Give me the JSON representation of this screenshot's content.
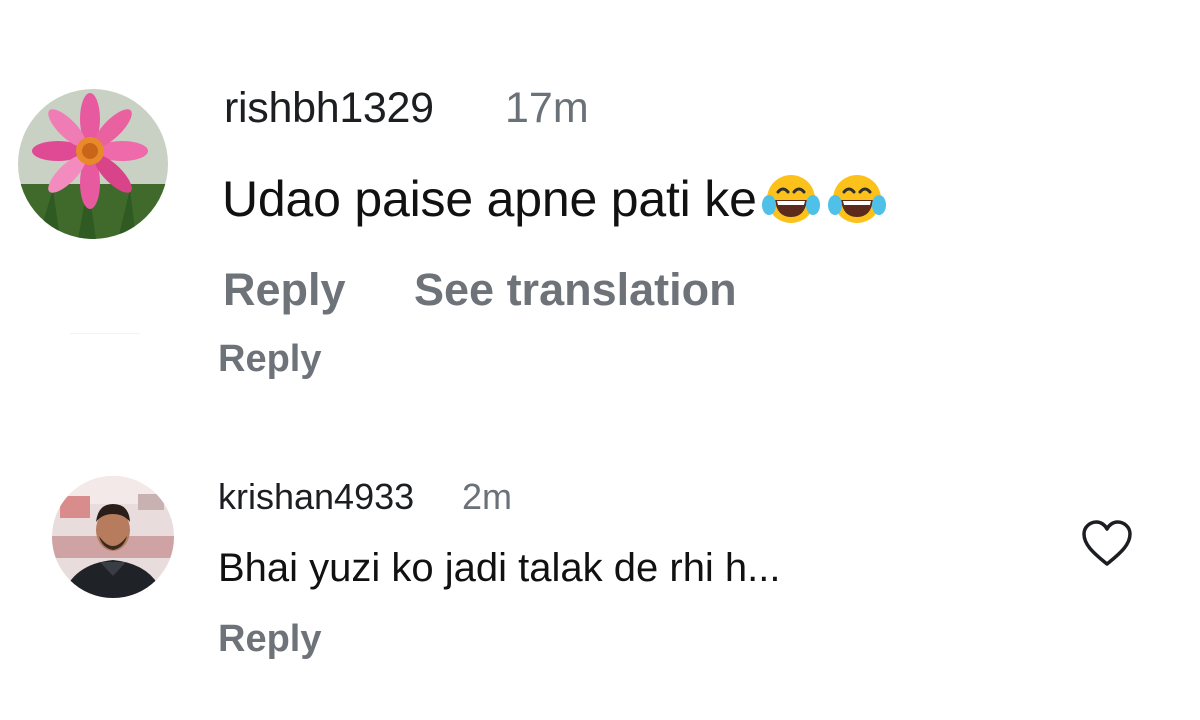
{
  "comments": [
    {
      "username": "rishbh1329",
      "time": "17m",
      "text": "Udao paise apne pati ke",
      "emojis": [
        "face-with-tears-of-joy-icon",
        "face-with-tears-of-joy-icon"
      ],
      "reply_label": "Reply",
      "translate_label": "See translation",
      "view_reply_label": "Reply"
    },
    {
      "username": "krishan4933",
      "time": "2m",
      "text": "Bhai yuzi ko jadi talak de rhi h...",
      "reply_label": "Reply",
      "like_icon": "heart-outline-icon"
    }
  ],
  "colors": {
    "text": "#1c1e21",
    "muted": "#6e737a",
    "background": "#ffffff"
  }
}
